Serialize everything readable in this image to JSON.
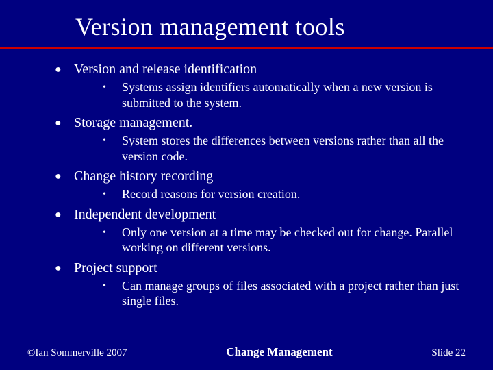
{
  "title": "Version management tools",
  "bullets": [
    {
      "text": "Version and release identification",
      "sub": [
        "Systems  assign identifiers automatically when a new version is submitted to the system."
      ]
    },
    {
      "text": "Storage management.",
      "sub": [
        "System stores the differences between versions rather than all the version code."
      ]
    },
    {
      "text": "Change history recording",
      "sub": [
        "Record reasons for version creation."
      ]
    },
    {
      "text": "Independent development",
      "sub": [
        "Only one version at a time may be checked out for change. Parallel working on different versions."
      ]
    },
    {
      "text": "Project support",
      "sub": [
        "Can manage groups of files associated with a project rather than just single files."
      ]
    }
  ],
  "footer": {
    "left": "©Ian Sommerville 2007",
    "center": "Change Management",
    "right": "Slide  22"
  }
}
